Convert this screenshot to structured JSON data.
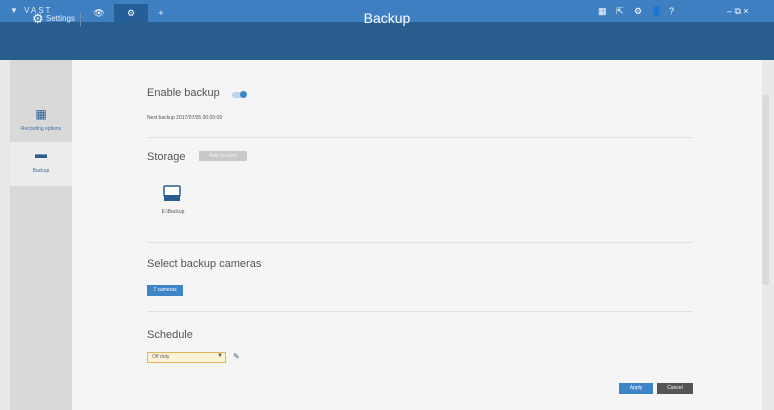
{
  "app": {
    "logo": "▼ VAST"
  },
  "tabs": [
    {
      "name": "live-view",
      "icon": "eye-icon",
      "glyph": "👁"
    },
    {
      "name": "settings",
      "icon": "gear-icon",
      "glyph": "⚙"
    },
    {
      "name": "add",
      "icon": "plus-icon",
      "glyph": "+"
    }
  ],
  "toolbar_right": [
    {
      "icon": "grid-icon",
      "glyph": "▦"
    },
    {
      "icon": "export-icon",
      "glyph": "⇱"
    },
    {
      "icon": "settings-icon",
      "glyph": "⚙"
    },
    {
      "icon": "user-icon",
      "glyph": "👤"
    },
    {
      "icon": "help-icon",
      "glyph": "?"
    },
    {
      "icon": "window-controls",
      "glyph": "–  ⧉  ×"
    }
  ],
  "header": {
    "settings_label": "Settings",
    "title": "Backup"
  },
  "sidebar": {
    "items": [
      {
        "label": "Recording options",
        "icon": "calendar-icon",
        "glyph": "▦"
      },
      {
        "label": "Backup",
        "icon": "backup-drive-icon",
        "glyph": "▬"
      }
    ]
  },
  "backup": {
    "enable_label": "Enable backup",
    "enabled": true,
    "next_backup": "Next backup 2017/07/05 00:00:09"
  },
  "storage": {
    "title": "Storage",
    "badge": "Add location",
    "drive_label": "E:\\Backup"
  },
  "cameras": {
    "title": "Select backup cameras",
    "button": "7 cameras"
  },
  "schedule": {
    "title": "Schedule",
    "selected": "Off duty"
  },
  "actions": {
    "apply": "Apply",
    "cancel": "Cancel"
  },
  "colors": {
    "topbar": "#3d7fc1",
    "header": "#295d8d",
    "accent": "#3d85c6",
    "cancel": "#555555"
  }
}
